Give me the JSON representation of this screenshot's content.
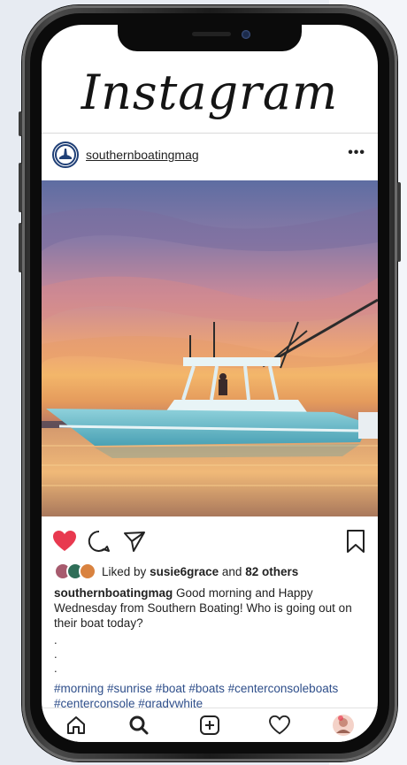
{
  "app": {
    "title": "Instagram"
  },
  "post": {
    "username": "southernboatingmag",
    "more_label": "•••",
    "likes": {
      "prefix": "Liked by",
      "user": "susie6grace",
      "and": "and",
      "others": "82 others"
    },
    "caption": {
      "author": "southernboatingmag",
      "text": "Good morning and Happy Wednesday from Southern Boating! Who is going out on their boat today?"
    },
    "dots": [
      ".",
      ".",
      "."
    ],
    "hashtags": "#morning #sunrise #boat #boats #centerconsoleboats #centerconsole #gradywhite"
  },
  "icons": {
    "like": "heart-icon",
    "comment": "comment-icon",
    "share": "send-icon",
    "save": "bookmark-icon",
    "tab_home": "home-icon",
    "tab_search": "search-icon",
    "tab_new": "new-post-icon",
    "tab_activity": "activity-icon",
    "tab_profile": "profile-icon"
  },
  "colors": {
    "like": "#e8394f",
    "hashtag": "#2e4e8a",
    "brand_navy": "#1f3f76"
  }
}
